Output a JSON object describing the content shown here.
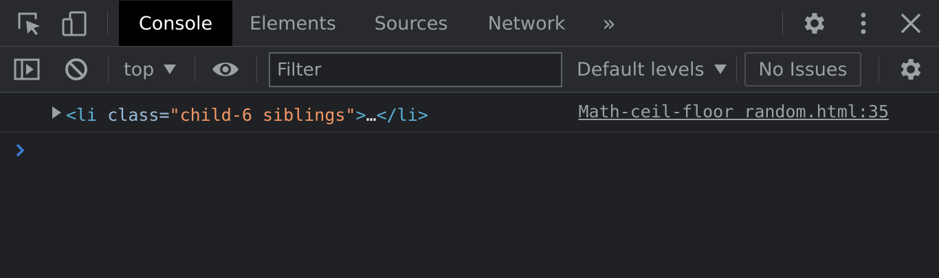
{
  "tabbar": {
    "tabs": [
      {
        "label": "Console",
        "active": true
      },
      {
        "label": "Elements",
        "active": false
      },
      {
        "label": "Sources",
        "active": false
      },
      {
        "label": "Network",
        "active": false
      }
    ],
    "more_tabs_label": "»"
  },
  "toolbar": {
    "context": "top",
    "filter_placeholder": "Filter",
    "filter_value": "",
    "levels": "Default levels",
    "issues": "No Issues"
  },
  "console": {
    "messages": [
      {
        "tag_open": "<li ",
        "attr_name": "class",
        "attr_eq": "=",
        "attr_value": "\"child-6 siblings\"",
        "tag_close_open": ">",
        "ellipsis": "…",
        "tag_end": "</li>",
        "source": "Math-ceil-floor random.html:35"
      }
    ],
    "prompt_symbol": "›"
  },
  "colors": {
    "background": "#202124",
    "toolbar": "#292a2d",
    "active_tab": "#000000",
    "tag": "#5db0d7",
    "attr_value": "#f29766",
    "prompt": "#3f7fd6"
  },
  "icons": [
    "select-element-icon",
    "device-toolbar-icon",
    "gear-icon",
    "kebab-menu-icon",
    "close-icon",
    "sidebar-toggle-icon",
    "clear-console-icon",
    "eye-icon",
    "settings-gear-icon",
    "expand-triangle-icon",
    "prompt-chevron-icon"
  ]
}
